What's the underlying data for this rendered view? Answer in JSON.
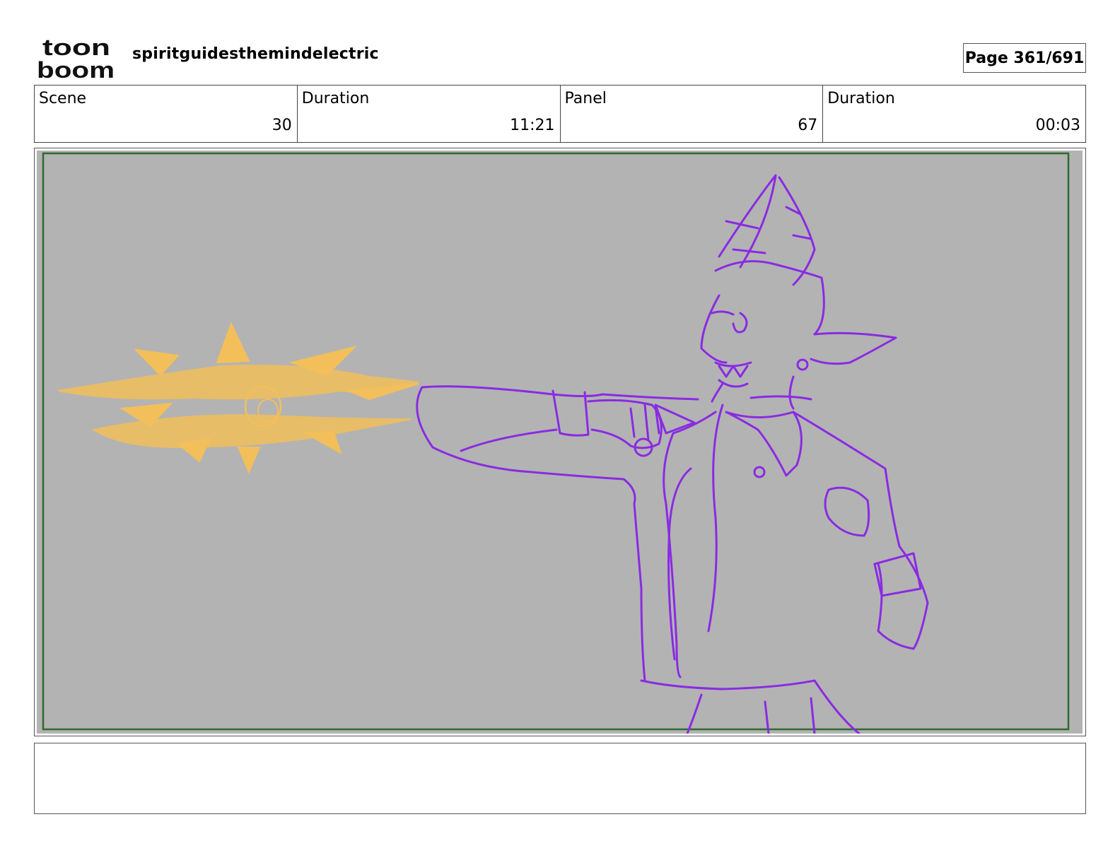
{
  "header": {
    "logo_line1": "toon",
    "logo_line2": "boom",
    "project_name": "spiritguidesthemindelectric",
    "page_indicator": "Page 361/691"
  },
  "info": {
    "scene_label": "Scene",
    "scene_value": "30",
    "scene_duration_label": "Duration",
    "scene_duration_value": "11:21",
    "panel_label": "Panel",
    "panel_value": "67",
    "panel_duration_label": "Duration",
    "panel_duration_value": "00:03"
  },
  "panel": {
    "background_color": "#b3b3b3",
    "frame_color": "#2e6b2e",
    "character_stroke": "#8a2be2",
    "fx_color": "#f2bf5a"
  },
  "notes": {
    "text": ""
  }
}
